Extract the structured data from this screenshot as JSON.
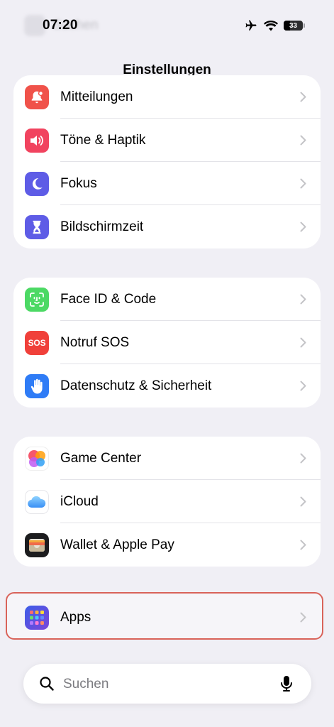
{
  "status_bar": {
    "time": "07:20",
    "battery_level": "33",
    "battery_fraction": 0.33,
    "icons": [
      "airplane-icon",
      "wifi-icon",
      "battery-icon"
    ]
  },
  "ghost_search_text": "Suchen",
  "header": {
    "title": "Einstellungen"
  },
  "groups": [
    {
      "items": [
        {
          "label": "Mitteilungen",
          "icon": "bell-icon",
          "icon_color": "#f0524a"
        },
        {
          "label": "Töne & Haptik",
          "icon": "speaker-icon",
          "icon_color": "#f1435f"
        },
        {
          "label": "Fokus",
          "icon": "moon-icon",
          "icon_color": "#5e5ce6"
        },
        {
          "label": "Bildschirmzeit",
          "icon": "hourglass-icon",
          "icon_color": "#5e5ce6"
        }
      ]
    },
    {
      "items": [
        {
          "label": "Face ID & Code",
          "icon": "faceid-icon",
          "icon_color": "#4cd964"
        },
        {
          "label": "Notruf SOS",
          "icon": "sos-icon",
          "icon_color": "#f0403a",
          "icon_text": "SOS"
        },
        {
          "label": "Datenschutz & Sicherheit",
          "icon": "hand-icon",
          "icon_color": "#2f7cf6"
        }
      ]
    },
    {
      "items": [
        {
          "label": "Game Center",
          "icon": "game-center-icon",
          "icon_color": "#ffffff"
        },
        {
          "label": "iCloud",
          "icon": "icloud-icon",
          "icon_color": "#ffffff"
        },
        {
          "label": "Wallet & Apple Pay",
          "icon": "wallet-icon",
          "icon_color": "#1c1c1e"
        }
      ]
    },
    {
      "items": [
        {
          "label": "Apps",
          "icon": "apps-icon",
          "icon_color": "#5b4fd6",
          "highlighted": true
        }
      ]
    }
  ],
  "search": {
    "placeholder": "Suchen",
    "icon": "search-icon",
    "mic_icon": "microphone-icon"
  },
  "colors": {
    "background": "#f0eff5",
    "highlight_border": "#d9635a",
    "chevron": "#c4c4c7"
  }
}
